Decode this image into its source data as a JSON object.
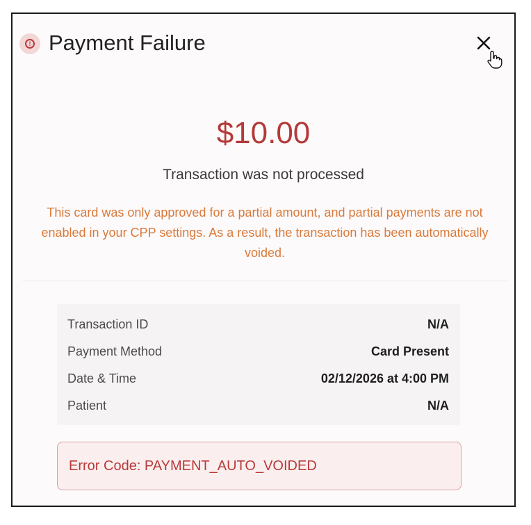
{
  "dialog": {
    "title": "Payment Failure",
    "alert_icon": "alert-circle-icon",
    "close_icon": "close-icon",
    "cursor_icon": "hand-pointer-cursor-icon"
  },
  "payment": {
    "amount": "$10.00",
    "status": "Transaction was not processed",
    "message": "This card was only approved for a partial amount, and partial payments are not enabled in your CPP settings. As a result, the transaction has been automatically voided."
  },
  "details": [
    {
      "label": "Transaction ID",
      "value": "N/A"
    },
    {
      "label": "Payment Method",
      "value": "Card Present"
    },
    {
      "label": "Date & Time",
      "value": "02/12/2026 at 4:00 PM"
    },
    {
      "label": "Patient",
      "value": "N/A"
    }
  ],
  "error": {
    "text": "Error Code: PAYMENT_AUTO_VOIDED"
  },
  "colors": {
    "accent_red": "#b43a3a",
    "warning_orange": "#d97a3a",
    "error_border": "#d8a0a0",
    "error_bg": "#fbeeee"
  }
}
